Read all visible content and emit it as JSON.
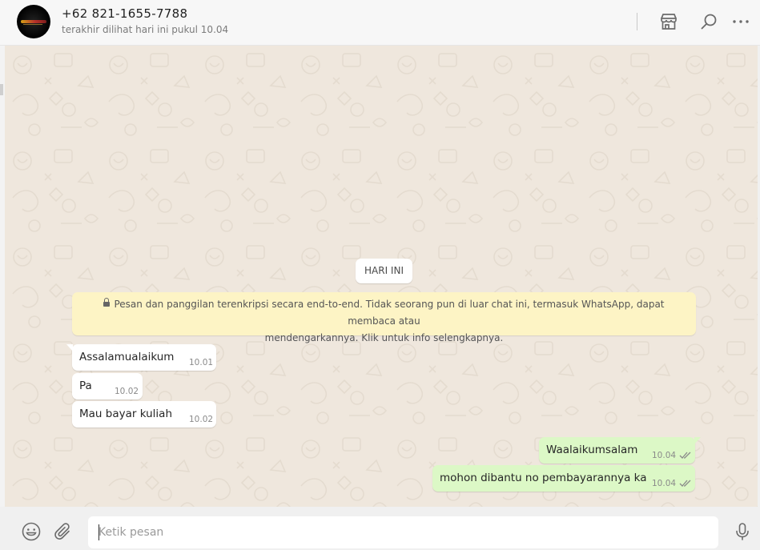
{
  "header": {
    "contact_name": "+62 821-1655-7788",
    "last_seen": "terakhir dilihat hari ini pukul 10.04",
    "icons": [
      "store-icon",
      "search-icon",
      "menu-icon"
    ]
  },
  "chat": {
    "date_chip": "HARI INI",
    "encryption_notice": {
      "line1": "Pesan dan panggilan terenkripsi secara end-to-end. Tidak seorang pun di luar chat ini, termasuk WhatsApp, dapat membaca atau",
      "line2": "mendengarkannya. Klik untuk info selengkapnya."
    },
    "messages": [
      {
        "direction": "in",
        "text": "Assalamualaikum",
        "time": "10.01"
      },
      {
        "direction": "in",
        "text": "Pa",
        "time": "10.02"
      },
      {
        "direction": "in",
        "text": "Mau bayar kuliah",
        "time": "10.02"
      },
      {
        "direction": "out",
        "text": "Waalaikumsalam",
        "time": "10.04",
        "status": "read"
      },
      {
        "direction": "out",
        "text": "mohon dibantu no pembayarannya ka",
        "time": "10.04",
        "status": "read"
      }
    ]
  },
  "composer": {
    "placeholder": "Ketik pesan",
    "value": ""
  },
  "colors": {
    "incoming_bubble": "#ffffff",
    "outgoing_bubble": "#dcf8c6",
    "chat_background": "#efe7dd",
    "notice_background": "#fdf4c5",
    "read_ticks": "#8a8a8a"
  }
}
